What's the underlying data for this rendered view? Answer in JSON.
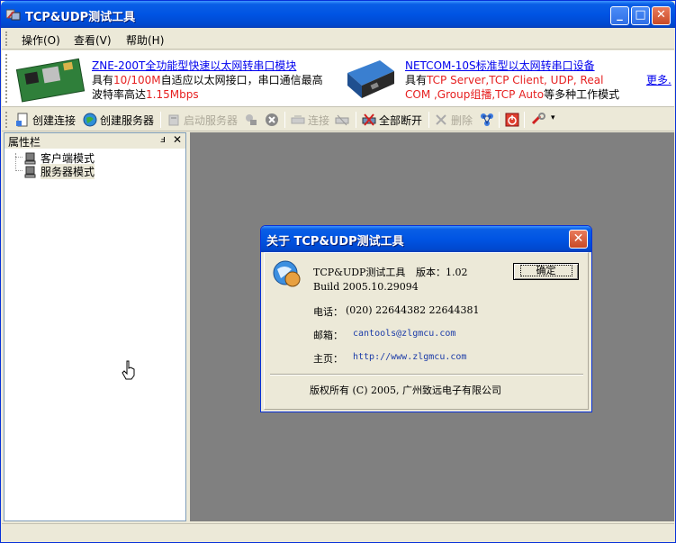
{
  "window": {
    "title": "TCP&UDP测试工具",
    "minimize": "_",
    "maximize": "□",
    "close": "✕"
  },
  "menu": {
    "items": [
      "操作(O)",
      "查看(V)",
      "帮助(H)"
    ]
  },
  "ads": {
    "ad1_title": "ZNE-200T全功能型快速以太网转串口模块",
    "ad1_line2_a": "具有",
    "ad1_line2_b": "10/100M",
    "ad1_line2_c": "自适应以太网接口，串口通信最高",
    "ad1_line3_a": "波特率高达",
    "ad1_line3_b": "1.15Mbps",
    "ad2_title": "NETCOM-10S标准型以太网转串口设备",
    "ad2_line2_a": "具有",
    "ad2_line2_b": "TCP Server,TCP Client, UDP, Real",
    "ad2_line3_a": "COM ,Group组播,TCP Auto",
    "ad2_line3_b": "等多种工作模式",
    "more": "更多."
  },
  "toolbar": {
    "create_conn": "创建连接",
    "create_server": "创建服务器",
    "start_server": "启动服务器",
    "connect": "连接",
    "disconnect_all": "全部断开",
    "delete": "删除"
  },
  "panel": {
    "title": "属性栏",
    "pin": "ⅎ",
    "close": "✕",
    "items": [
      "客户端模式",
      "服务器模式"
    ]
  },
  "dialog": {
    "title": "关于 TCP&UDP测试工具",
    "close": "✕",
    "app_name": "TCP&UDP测试工具",
    "version_label": "版本：1.02",
    "build": "Build 2005.10.29094",
    "phone_label": "电话：",
    "phone_value": "(020) 22644382 22644381",
    "email_label": "邮箱：",
    "email_value": "cantools@zlgmcu.com",
    "homepage_label": "主页：",
    "homepage_value": "http://www.zlgmcu.com",
    "copyright": "版权所有 (C) 2005, 广州致远电子有限公司",
    "ok": "确定"
  },
  "colors": {
    "titlebar": "#0054e3",
    "mdi_bg": "#808080",
    "link": "#0000ee",
    "highlight_red": "#e62020"
  }
}
